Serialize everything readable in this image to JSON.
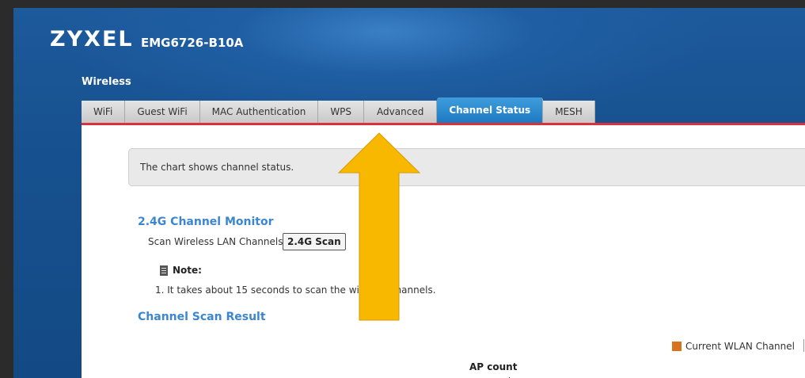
{
  "header": {
    "brand": "ZYXEL",
    "model": "EMG6726-B10A"
  },
  "section": {
    "title": "Wireless"
  },
  "tabs": [
    {
      "label": "WiFi"
    },
    {
      "label": "Guest WiFi"
    },
    {
      "label": "MAC Authentication"
    },
    {
      "label": "WPS"
    },
    {
      "label": "Advanced"
    },
    {
      "label": "Channel Status",
      "active": true
    },
    {
      "label": "MESH"
    }
  ],
  "info": {
    "text": "The chart shows channel status."
  },
  "monitor": {
    "title": "2.4G Channel Monitor",
    "scan_label": "Scan Wireless LAN Channels",
    "scan_button": "2.4G Scan"
  },
  "note": {
    "label": "Note:",
    "item": "1. It takes about 15 seconds to scan the wireless channels."
  },
  "result": {
    "title": "Channel Scan Result"
  },
  "chart": {
    "legend": "Current WLAN Channel",
    "legend_color": "#d7731a",
    "y_label": "AP count"
  },
  "overlay": {
    "arrow_color": "#f9b800",
    "arrow_shape": "up-arrow"
  }
}
